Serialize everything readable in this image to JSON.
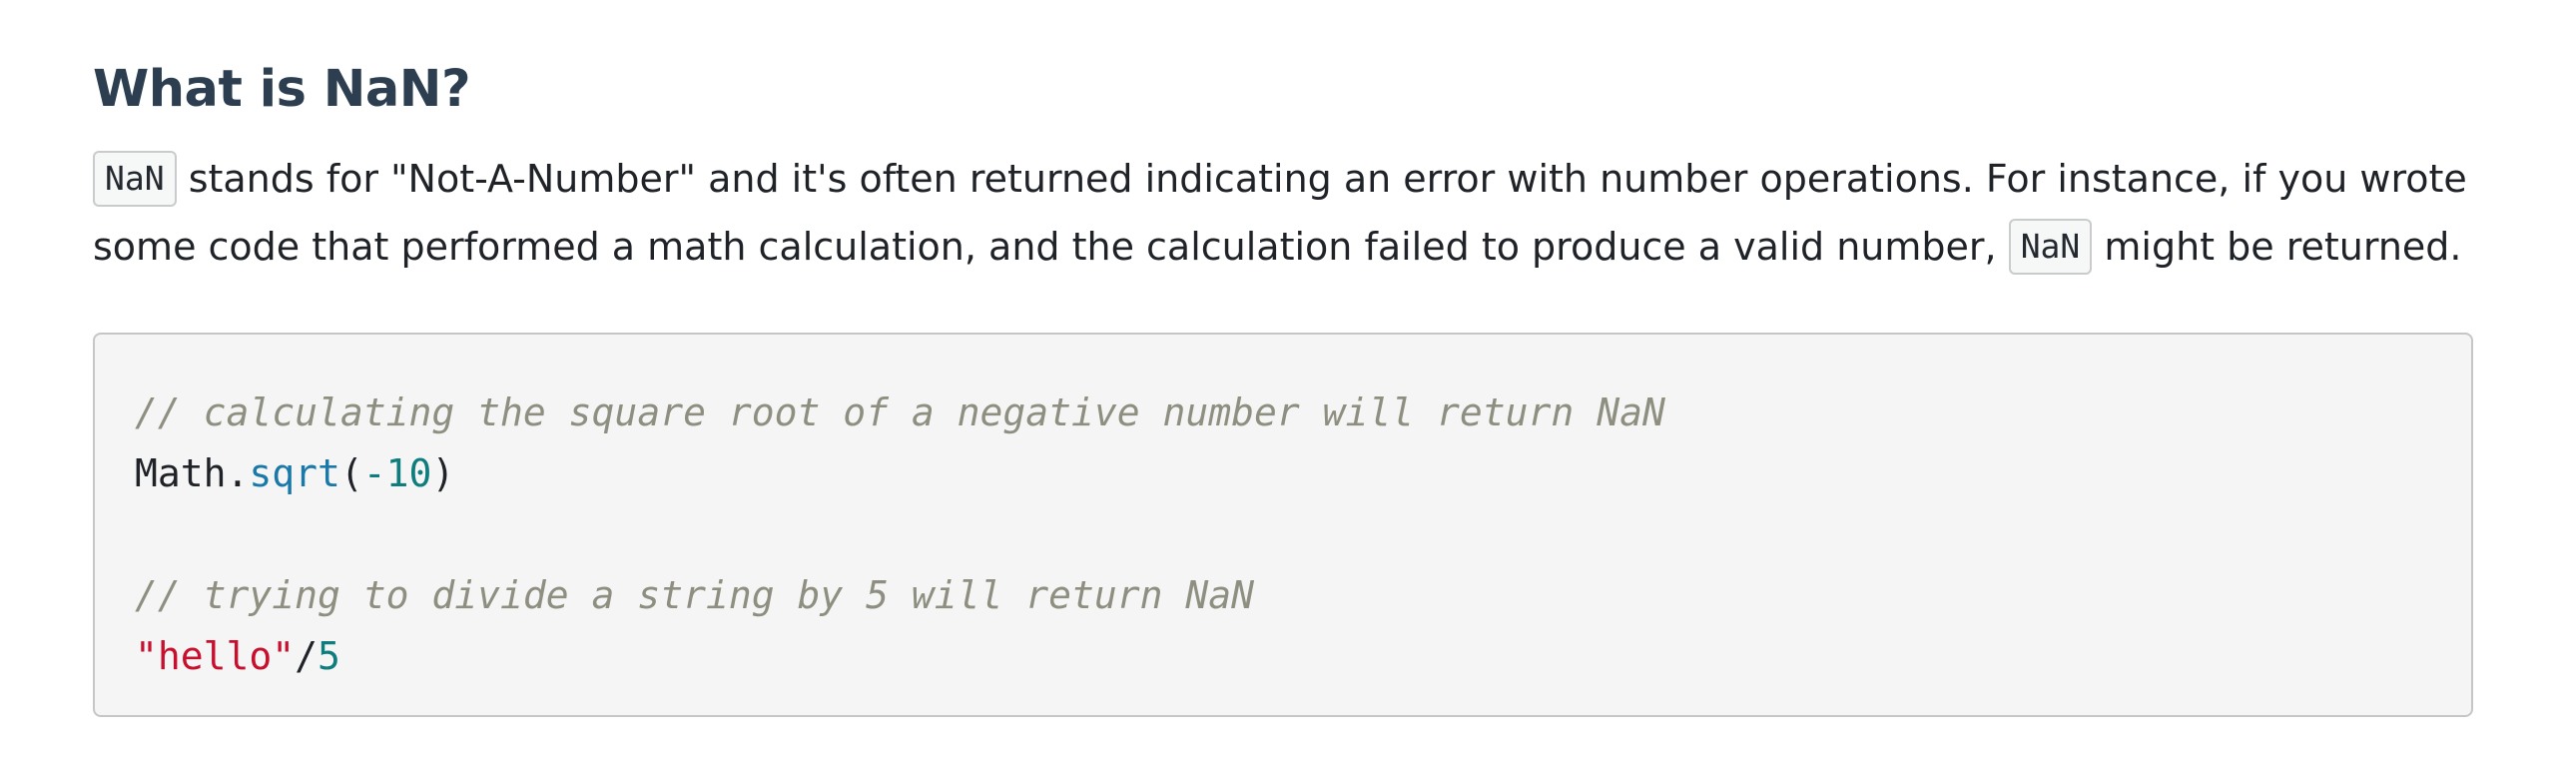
{
  "heading": "What is NaN?",
  "paragraph": {
    "line1": {
      "code1": "NaN",
      "text1": " stands for \"Not-A-Number\" and it's often returned indicating an error with number operations. For instance, if you wrote"
    },
    "line2": {
      "text1": "some code that performed a math calculation, and the calculation failed to produce a valid number, ",
      "code1": "NaN",
      "text2": " might be returned."
    }
  },
  "code_block": {
    "line1": {
      "comment": "// calculating the square root of a negative number will return NaN"
    },
    "line2": {
      "object": "Math.",
      "method": "sqrt",
      "open": "(",
      "number": "-10",
      "close": ")"
    },
    "line3": {
      "blank": " "
    },
    "line4": {
      "comment": "// trying to divide a string by 5 will return NaN"
    },
    "line5": {
      "string": "\"hello\"",
      "operator": "/",
      "number": "5"
    }
  },
  "colors": {
    "heading": "#2c3e50",
    "comment": "#8f8f81",
    "function": "#1a79a8",
    "number": "#0f7d7d",
    "string": "#c8102e",
    "code_bg": "#f5f5f5"
  }
}
